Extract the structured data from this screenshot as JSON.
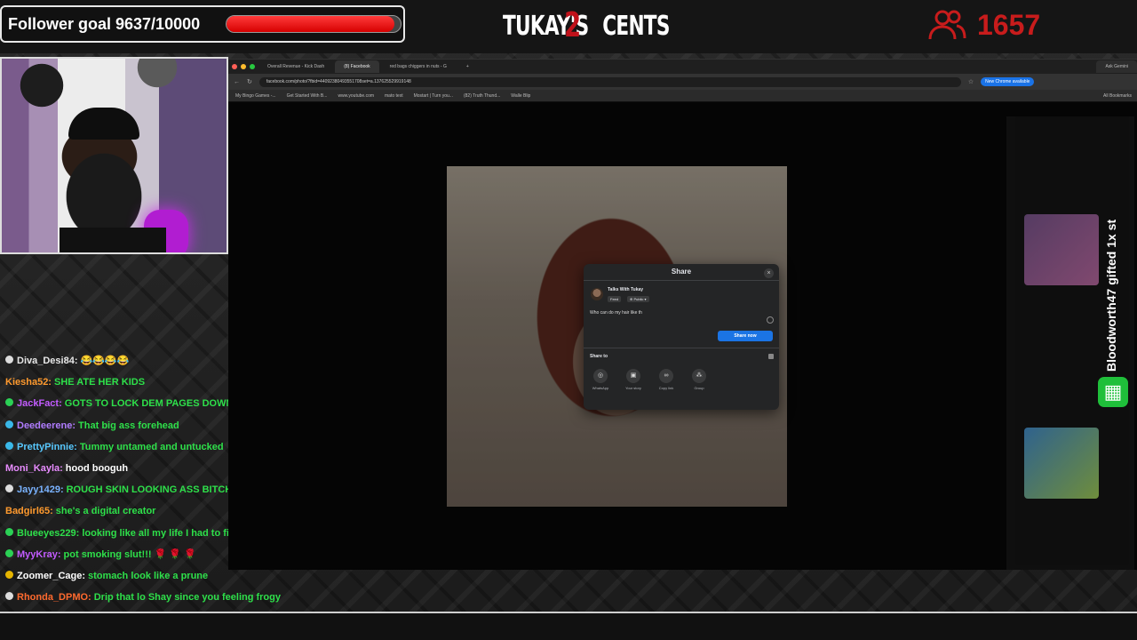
{
  "overlay": {
    "follower_goal": "Follower goal 9637/10000",
    "goal_progress": 0.9637,
    "brand": "TUKAY'S",
    "brand_two": "2",
    "brand_cents": "CENTS",
    "viewer_count": "1657"
  },
  "chat": [
    {
      "user": "Diva_Desi84:",
      "text": "😂😂😂😂",
      "user_color": "#e8e8e8",
      "text_color": "#ffffff",
      "badge": ""
    },
    {
      "user": "Kiesha52:",
      "text": "SHE ATE HER KIDS",
      "user_color": "#ff9a2e",
      "text_color": "#2ee04a",
      "badge": "none"
    },
    {
      "user": "JackFact:",
      "text": "GOTS TO LOCK DEM PAGES DOWN",
      "user_color": "#c25bff",
      "text_color": "#2ee04a",
      "badge": "green"
    },
    {
      "user": "Deedeerene:",
      "text": "That big ass forehead",
      "user_color": "#b07cff",
      "text_color": "#2ee04a",
      "badge": "cyan"
    },
    {
      "user": "PrettyPinnie:",
      "text": "Tummy untamed and untucked",
      "user_color": "#58c9ff",
      "text_color": "#2ee04a",
      "badge": "cyan"
    },
    {
      "user": "Moni_Kayla:",
      "text": "hood booguh",
      "user_color": "#e88cff",
      "text_color": "#ffffff",
      "badge": "none"
    },
    {
      "user": "Jayy1429:",
      "text": "ROUGH SKIN LOOKING ASS BITCH",
      "user_color": "#7ab3ff",
      "text_color": "#2ee04a",
      "badge": ""
    },
    {
      "user": "Badgirl65:",
      "text": "she's a digital creator",
      "user_color": "#ff9a2e",
      "text_color": "#2ee04a",
      "badge": "none"
    },
    {
      "user": "Blueeyes229:",
      "text": "looking like all my life I had to fight.",
      "user_color": "#2ee04a",
      "text_color": "#2ee04a",
      "badge": "green"
    },
    {
      "user": "MyyKray:",
      "text": "pot smoking slut!!! 🌹 🌹 🌹",
      "user_color": "#c25bff",
      "text_color": "#2ee04a",
      "badge": "green"
    },
    {
      "user": "Zoomer_Cage:",
      "text": "stomach look like a prune",
      "user_color": "#ffffff",
      "text_color": "#2ee04a",
      "badge": "yellow"
    },
    {
      "user": "Rhonda_DPMO:",
      "text": "Drip that lo Shay since you feeling frogy",
      "user_color": "#ff6a2e",
      "text_color": "#2ee04a",
      "badge": ""
    }
  ],
  "browser": {
    "tabs": [
      "Overall Revenue - Kick Dash",
      "(8) Facebook",
      "red bags chiggers in nuts - G"
    ],
    "address": "facebook.com/photo/?fbid=44092380493551708set=a.137625529919148",
    "new_chrome": "New Chrome available",
    "ask_gemini": "Ask Gemini",
    "bookmarks": [
      "My Bingo Games -...",
      "Get Started With B...",
      "www.youtube.com",
      "mato text",
      "Mostart | Turn you...",
      "(82) Truth Thund...",
      "Walle Blip",
      "All Bookmarks"
    ]
  },
  "share_dialog": {
    "title": "Share",
    "close": "×",
    "account": "Talks With Tukay",
    "feed_chip": "Feed",
    "public_chip": "Public",
    "compose_text": "Who can do my hair like th",
    "share_now": "Share now",
    "share_to": "Share to",
    "targets": [
      {
        "label": "WhatsApp",
        "icon": "whatsapp-icon",
        "glyph": "◎"
      },
      {
        "label": "Your story",
        "icon": "story-icon",
        "glyph": "▣"
      },
      {
        "label": "Copy link",
        "icon": "link-icon",
        "glyph": "∞"
      },
      {
        "label": "Group",
        "icon": "group-icon",
        "glyph": "⁂"
      }
    ]
  },
  "gift_banner": {
    "text": "Bloodworth47 gifted 1x st"
  },
  "colors": {
    "goal_fill": "#e00000",
    "viewer_red": "#c81c1c",
    "share_blue": "#1b74e4"
  }
}
